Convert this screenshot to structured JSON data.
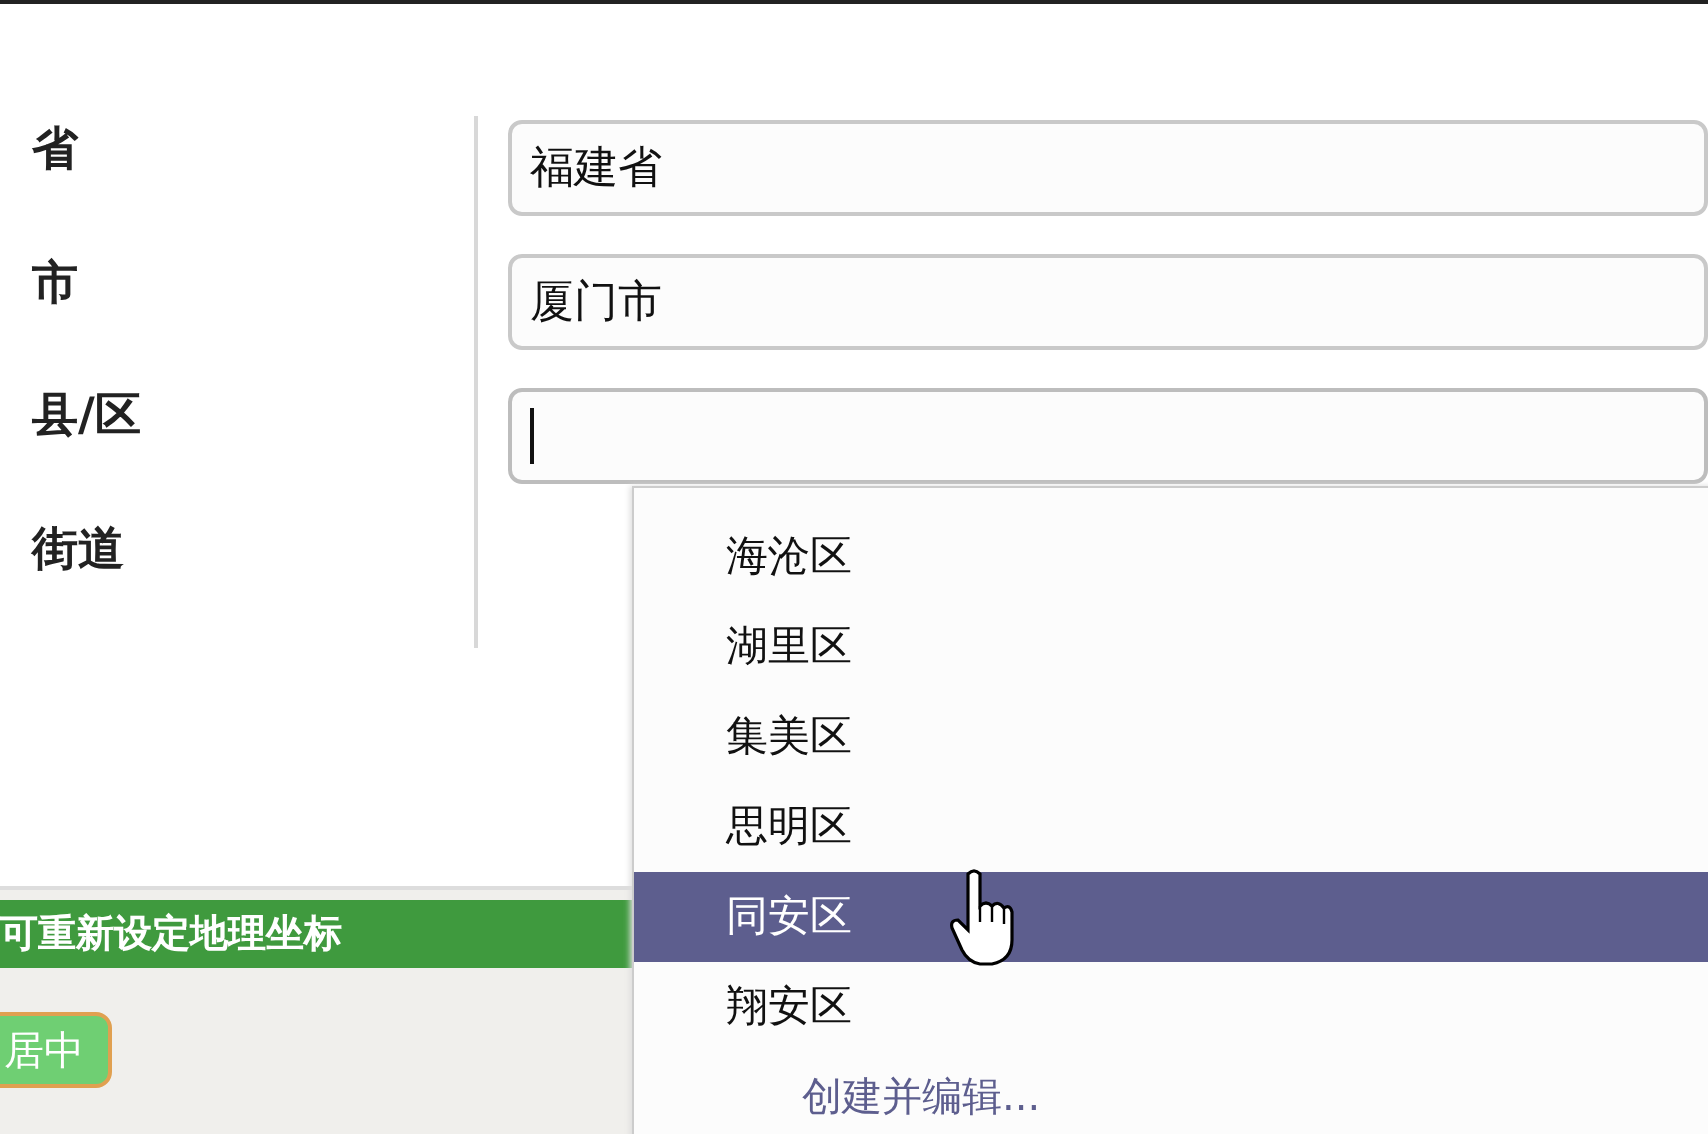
{
  "labels": [
    "省",
    "市",
    "县/区",
    "街道"
  ],
  "fields": [
    {
      "value": "福建省",
      "focused": false
    },
    {
      "value": "厦门市",
      "focused": false
    },
    {
      "focused": true
    }
  ],
  "dropdown": {
    "options": [
      {
        "label": "海沧区",
        "selected": false
      },
      {
        "label": "湖里区",
        "selected": false
      },
      {
        "label": "集美区",
        "selected": false
      },
      {
        "label": "思明区",
        "selected": false
      },
      {
        "label": "同安区",
        "selected": true
      },
      {
        "label": "翔安区",
        "selected": false
      }
    ],
    "create_link": "创建并编辑..."
  },
  "bottom_panel": {
    "banner": "可重新设定地理坐标",
    "button": "居中"
  }
}
